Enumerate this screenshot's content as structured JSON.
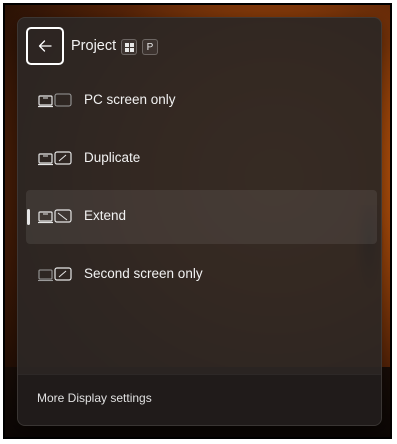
{
  "panel": {
    "title": "Project",
    "back_icon": "arrow-left-icon",
    "shortcut": {
      "win_icon": "windows-logo-icon",
      "key": "P"
    }
  },
  "options": [
    {
      "label": "PC screen only",
      "icon": "pc-screen-only-icon",
      "selected": false
    },
    {
      "label": "Duplicate",
      "icon": "duplicate-icon",
      "selected": false
    },
    {
      "label": "Extend",
      "icon": "extend-icon",
      "selected": true
    },
    {
      "label": "Second screen only",
      "icon": "second-screen-only-icon",
      "selected": false
    }
  ],
  "footer": {
    "link_label": "More Display settings"
  },
  "colors": {
    "panel_bg": "#2c2624",
    "text": "#f2f2f2",
    "accent_bar": "#e6e6e6"
  }
}
